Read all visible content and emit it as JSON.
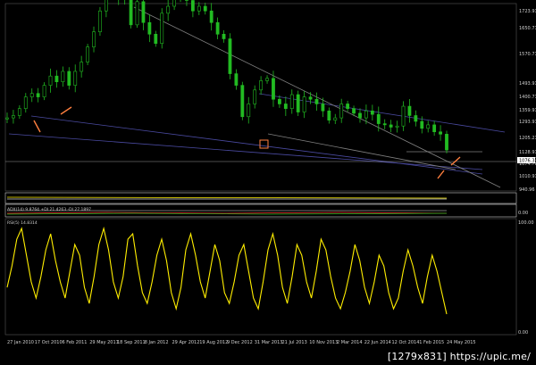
{
  "chart_data": {
    "type": "line",
    "main": {
      "series_name": "",
      "values": [
        1240,
        1250,
        1280,
        1330,
        1345,
        1330,
        1380,
        1420,
        1395,
        1440,
        1380,
        1440,
        1480,
        1545,
        1610,
        1700,
        1900,
        1810,
        1750,
        1790,
        1640,
        1740,
        1650,
        1600,
        1560,
        1690,
        1720,
        1770,
        1760,
        1745,
        1700,
        1720,
        1700,
        1650,
        1600,
        1580,
        1430,
        1380,
        1245,
        1300,
        1360,
        1400,
        1410,
        1320,
        1300,
        1280,
        1340,
        1265,
        1330,
        1320,
        1300,
        1270,
        1230,
        1240,
        1300,
        1280,
        1260,
        1240,
        1270,
        1255,
        1215,
        1210,
        1200,
        1205,
        1290,
        1250,
        1225,
        1195,
        1210,
        1180,
        1170,
        1102
      ],
      "price_ticks": [
        "1723.91",
        "1650.71",
        "1570.71",
        "1493.91",
        "1400.71",
        "1359.91",
        "1293.91",
        "1205.21",
        "1128.91",
        "1076.31",
        "1074.76",
        "1010.91",
        "940.96"
      ],
      "current_price": "1076.31",
      "current_price_2": "1074.76",
      "ylim": [
        940.96,
        1723.91
      ]
    },
    "x_ticks": [
      "27 Jan 2010",
      "17 Oct 2010",
      "6 Feb 2011",
      "29 May 2011",
      "18 Sep 2011",
      "8 Jan 2012",
      "29 Apr 2012",
      "19 Aug 2012",
      "9 Dec 2012",
      "31 Mar 2013",
      "21 Jul 2013",
      "10 Nov 2013",
      "2 Mar 2014",
      "22 Jun 2014",
      "12 Oct 2014",
      "1 Feb 2015",
      "24 May 2015"
    ],
    "adx_label": "ADX(14) 9.8764 +DI 21.4263 -DI 27.1897",
    "adx_ticks": [
      "0.00"
    ],
    "rsi": {
      "label": "RSI(5) 14.8314",
      "ticks": [
        "100.00",
        "0.00"
      ],
      "values": [
        40,
        60,
        85,
        95,
        70,
        45,
        30,
        50,
        75,
        90,
        65,
        45,
        30,
        55,
        80,
        70,
        40,
        25,
        50,
        80,
        95,
        75,
        45,
        30,
        50,
        85,
        90,
        60,
        35,
        25,
        45,
        70,
        85,
        65,
        35,
        20,
        40,
        75,
        90,
        70,
        45,
        30,
        55,
        80,
        65,
        35,
        25,
        45,
        70,
        80,
        55,
        30,
        20,
        45,
        75,
        90,
        70,
        40,
        25,
        50,
        80,
        70,
        45,
        30,
        55,
        85,
        75,
        50,
        30,
        20,
        35,
        55,
        80,
        65,
        40,
        25,
        45,
        70,
        60,
        35,
        20,
        30,
        55,
        75,
        60,
        40,
        25,
        50,
        70,
        55,
        35,
        15
      ]
    }
  },
  "watermark": "[1279x831] https://upic.me/",
  "colors": {
    "background": "#000000",
    "candles": "#22bb22",
    "trendline": "#4a4aa0",
    "channel": "#808080",
    "arrow": "#ff7f3f",
    "highlight_box": "#ff7f3f",
    "rsi_line": "#ffee00",
    "adx_line": "#c0c0c0"
  }
}
